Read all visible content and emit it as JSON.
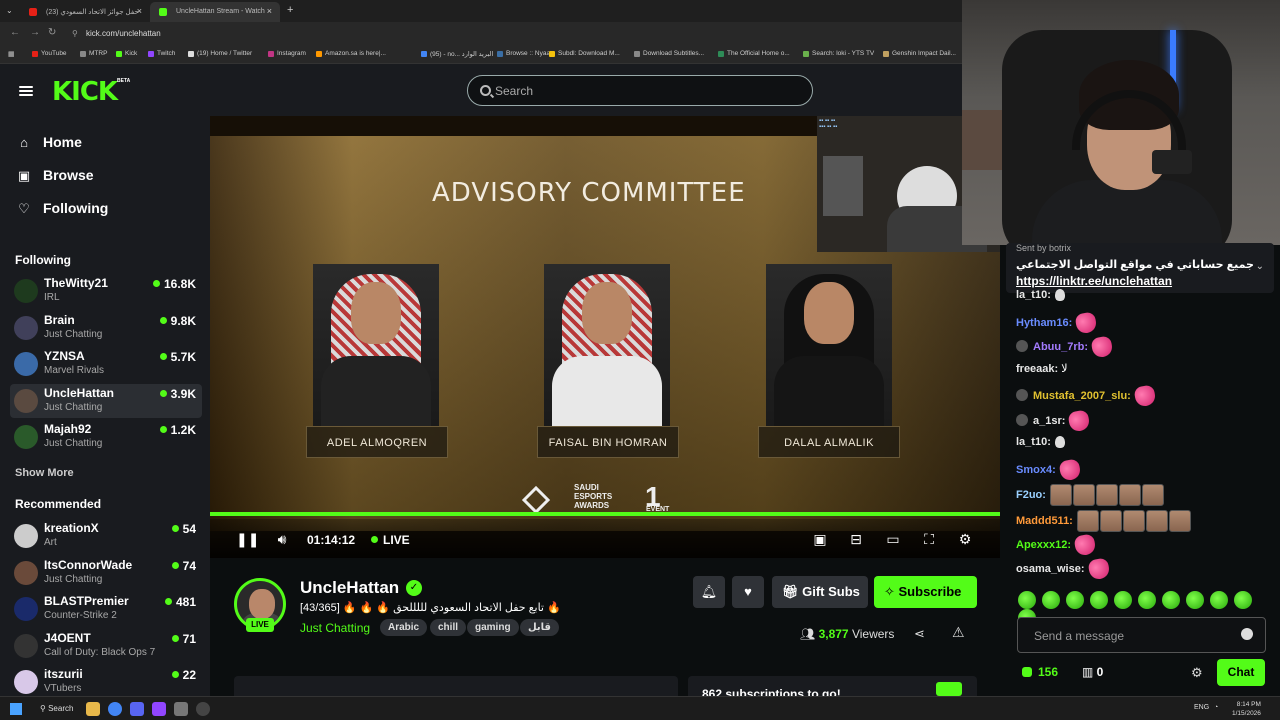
{
  "browser": {
    "tabs": [
      {
        "title": "حفل جوائز الاتحاد السعودي (23)",
        "color": "#e62117"
      },
      {
        "title": "UncleHattan Stream - Watch",
        "color": "#53fc18"
      }
    ],
    "url": "kick.com/unclehattan",
    "bookmarks": [
      {
        "label": "YouTube",
        "color": "#e62117"
      },
      {
        "label": "MTRP",
        "color": "#888888"
      },
      {
        "label": "Kick",
        "color": "#53fc18"
      },
      {
        "label": "Twitch",
        "color": "#9146ff"
      },
      {
        "label": "(19) Home / Twitter",
        "color": "#dddddd"
      },
      {
        "label": "Instagram",
        "color": "#c13584"
      },
      {
        "label": "Amazon.sa is here|...",
        "color": "#ff9900"
      },
      {
        "label": "(95) - no... البريد الوارد",
        "color": "#4285f4"
      },
      {
        "label": "Browse :: Nyaa",
        "color": "#3a6ea5"
      },
      {
        "label": "Subdl: Download M...",
        "color": "#f4c20d"
      },
      {
        "label": "Download Subtitles...",
        "color": "#888888"
      },
      {
        "label": "The Official Home o...",
        "color": "#2e8b57"
      },
      {
        "label": "Search: loki - YTS TV",
        "color": "#6ab04c"
      },
      {
        "label": "Genshin Impact Dail...",
        "color": "#c0a060"
      }
    ]
  },
  "header": {
    "logo": "KICK",
    "beta": "BETA",
    "search_placeholder": "Search"
  },
  "sidebar": {
    "nav": [
      {
        "label": "Home",
        "icon": "⌂"
      },
      {
        "label": "Browse",
        "icon": "▣"
      },
      {
        "label": "Following",
        "icon": "♡"
      }
    ],
    "following_title": "Following",
    "following": [
      {
        "name": "TheWitty21",
        "category": "IRL",
        "viewers": "16.8K",
        "color": "#1e3a1e"
      },
      {
        "name": "Brain",
        "category": "Just Chatting",
        "viewers": "9.8K",
        "color": "#40405a"
      },
      {
        "name": "YZNSA",
        "category": "Marvel Rivals",
        "viewers": "5.7K",
        "color": "#3a6aa8"
      },
      {
        "name": "UncleHattan",
        "category": "Just Chatting",
        "viewers": "3.9K",
        "color": "#5a4a40"
      },
      {
        "name": "Majah92",
        "category": "Just Chatting",
        "viewers": "1.2K",
        "color": "#2a5a2a"
      }
    ],
    "show_more": "Show More",
    "recommended_title": "Recommended",
    "recommended": [
      {
        "name": "kreationX",
        "category": "Art",
        "viewers": "54",
        "color": "#cccccc"
      },
      {
        "name": "ItsConnorWade",
        "category": "Just Chatting",
        "viewers": "74",
        "color": "#6a4a3a"
      },
      {
        "name": "BLASTPremier",
        "category": "Counter-Strike 2",
        "viewers": "481",
        "color": "#1a2a6a"
      },
      {
        "name": "J4OENT",
        "category": "Call of Duty: Black Ops 7",
        "viewers": "71",
        "color": "#333333"
      },
      {
        "name": "itszurii",
        "category": "VTubers",
        "viewers": "22",
        "color": "#d8c8e8"
      }
    ]
  },
  "video": {
    "slide_title": "ADVISORY COMMITTEE",
    "people": [
      "ADEL ALMOQREN",
      "FAISAL BIN HOMRAN",
      "DALAL ALMALIK"
    ],
    "logo_text": "SAUDI\nESPORTS\nAWARDS",
    "event_text": "EVENT",
    "time": "01:14:12",
    "live_label": "LIVE",
    "progress": 1.0
  },
  "stream": {
    "streamer": "UncleHattan",
    "live_badge": "LIVE",
    "title": "[43/365] 🔥 🔥 🔥 تابع حفل الاتحاد السعودي لللللحق 🔥",
    "category": "Just Chatting",
    "tags": [
      "Arabic",
      "chill",
      "gaming",
      "قابل"
    ],
    "gift_label": "Gift Subs",
    "subscribe_label": "Subscribe",
    "viewers_count": "3,877",
    "viewers_label": "Viewers",
    "sub_goal": "862 subscriptions to go!"
  },
  "chat": {
    "pinned_sent": "Sent by  botrix",
    "pinned_text": "جميع حساباتي في مواقع التواصل الاجتماعي",
    "pinned_link": "https://linktr.ee/unclehattan",
    "messages": [
      {
        "user": "la_t10:",
        "color": "#e8e8e8",
        "emote": "hand",
        "count": 1
      },
      {
        "user": "Hytham16:",
        "color": "#6a8cff",
        "emote": "heart",
        "count": 1
      },
      {
        "user": "Abuu_7rb:",
        "color": "#a47cff",
        "emote": "heart",
        "count": 1,
        "badge": true
      },
      {
        "user": "freeaak:",
        "color": "#e8e8e8",
        "text": "لا",
        "count": 0
      },
      {
        "user": "Mustafa_2007_slu:",
        "color": "#e0c030",
        "emote": "heart",
        "count": 1,
        "badge": true
      },
      {
        "user": "a_1sr:",
        "color": "#e8e8e8",
        "emote": "heart",
        "count": 1,
        "badge": true
      },
      {
        "user": "la_t10:",
        "color": "#e8e8e8",
        "emote": "hand",
        "count": 1
      },
      {
        "user": "Smox4:",
        "color": "#6a8cff",
        "emote": "heart",
        "count": 1
      },
      {
        "user": "F2uo:",
        "color": "#9ad0ff",
        "emote": "face",
        "count": 5
      },
      {
        "user": "Maddd511:",
        "color": "#ff9a3a",
        "emote": "face",
        "count": 5
      },
      {
        "user": "Apexxx12:",
        "color": "#53fc18",
        "emote": "heart",
        "count": 1
      },
      {
        "user": "osama_wise:",
        "color": "#e8e8e8",
        "emote": "heart",
        "count": 1
      }
    ],
    "input_placeholder": "Send a message",
    "points": "156",
    "store": "0",
    "chat_button": "Chat"
  },
  "taskbar": {
    "search": "Search",
    "lang": "ENG",
    "time": "8:14 PM",
    "date": "1/15/2026"
  }
}
